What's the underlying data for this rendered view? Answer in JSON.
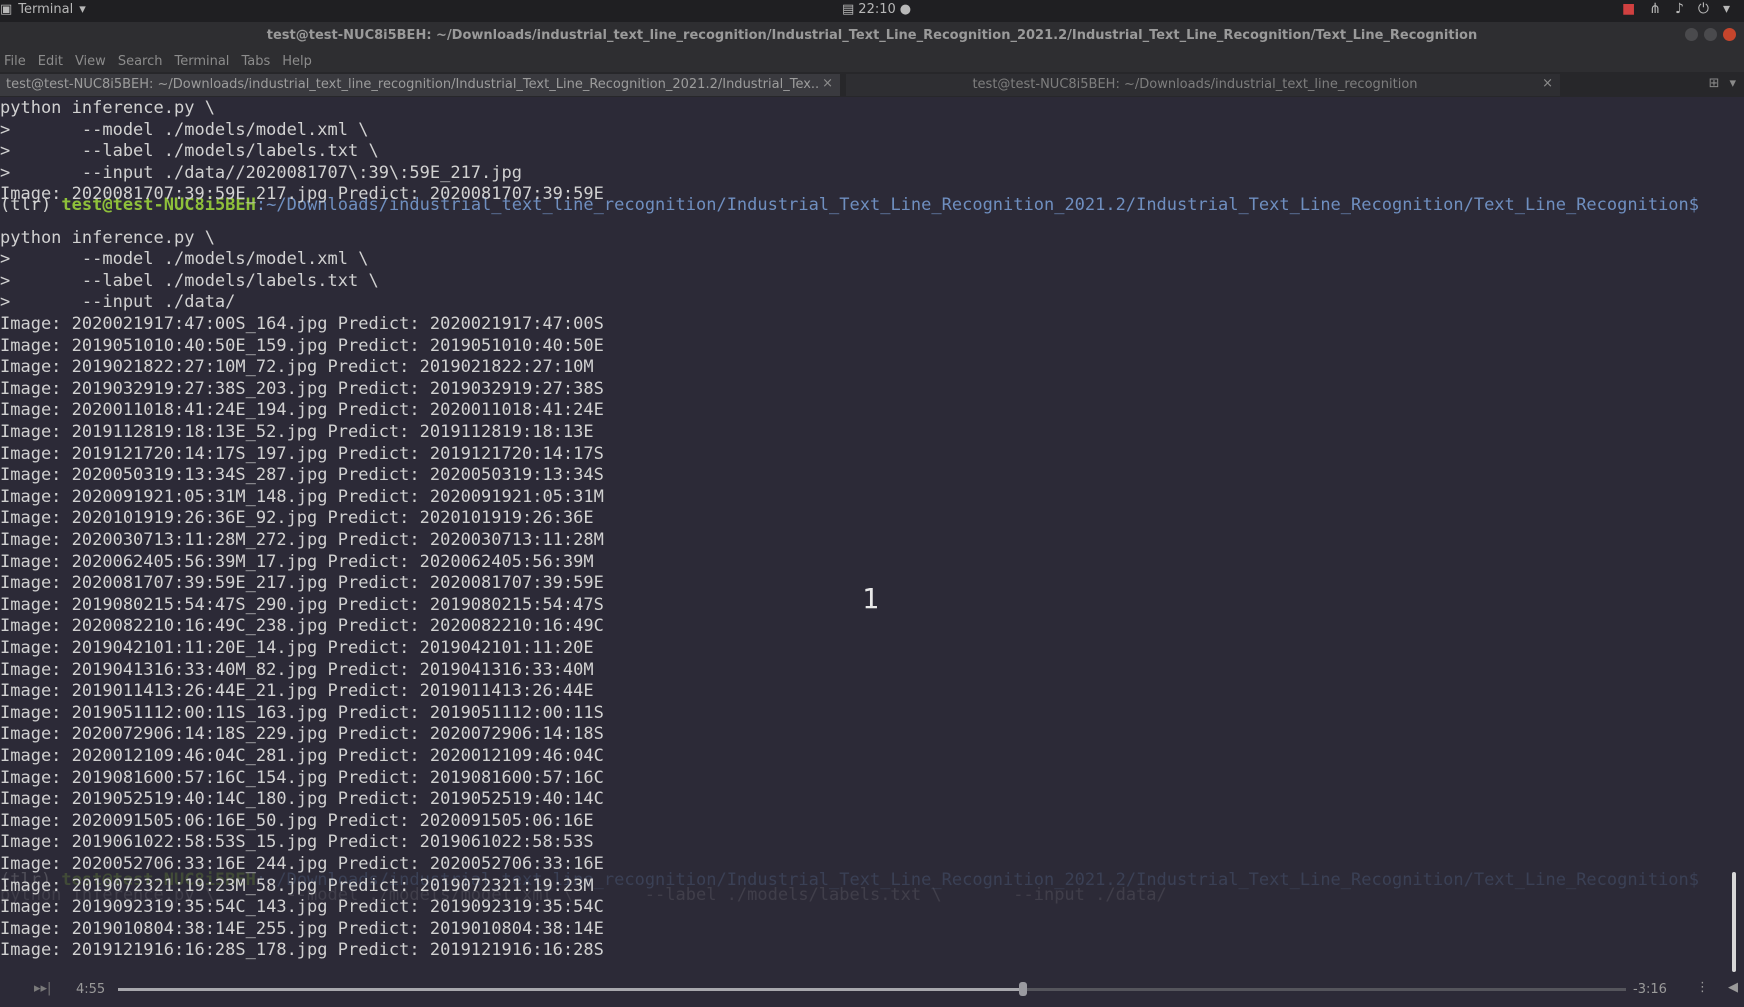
{
  "system_bar": {
    "app_name": "Terminal",
    "clock": "22:10"
  },
  "window": {
    "title": "test@test-NUC8i5BEH: ~/Downloads/industrial_text_line_recognition/Industrial_Text_Line_Recognition_2021.2/Industrial_Text_Line_Recognition/Text_Line_Recognition"
  },
  "menu": [
    "File",
    "Edit",
    "View",
    "Search",
    "Terminal",
    "Tabs",
    "Help"
  ],
  "tabs": [
    {
      "label": "test@test-NUC8i5BEH: ~/Downloads/industrial_text_line_recognition/Industrial_Text_Line_Recognition_2021.2/Industrial_Tex..."
    },
    {
      "label": "test@test-NUC8i5BEH: ~/Downloads/industrial_text_line_recognition"
    }
  ],
  "prompt": {
    "env": "(tlr) ",
    "user": "test@test-NUC8i5BEH",
    "path": ":~/Downloads/industrial_text_line_recognition/Industrial_Text_Line_Recognition_2021.2/Industrial_Text_Line_Recognition/Text_Line_Recognition$"
  },
  "terminal_lines": [
    "python inference.py \\",
    ">       --model ./models/model.xml \\",
    ">       --label ./models/labels.txt \\",
    ">       --input ./data//2020081707\\:39\\:59E_217.jpg",
    "Image: 2020081707:39:59E_217.jpg Predict: 2020081707:39:59E",
    "",
    "python inference.py \\",
    ">       --model ./models/model.xml \\",
    ">       --label ./models/labels.txt \\",
    ">       --input ./data/",
    "Image: 2020021917:47:00S_164.jpg Predict: 2020021917:47:00S",
    "Image: 2019051010:40:50E_159.jpg Predict: 2019051010:40:50E",
    "Image: 2019021822:27:10M_72.jpg Predict: 2019021822:27:10M",
    "Image: 2019032919:27:38S_203.jpg Predict: 2019032919:27:38S",
    "Image: 2020011018:41:24E_194.jpg Predict: 2020011018:41:24E",
    "Image: 2019112819:18:13E_52.jpg Predict: 2019112819:18:13E",
    "Image: 2019121720:14:17S_197.jpg Predict: 2019121720:14:17S",
    "Image: 2020050319:13:34S_287.jpg Predict: 2020050319:13:34S",
    "Image: 2020091921:05:31M_148.jpg Predict: 2020091921:05:31M",
    "Image: 2020101919:26:36E_92.jpg Predict: 2020101919:26:36E",
    "Image: 2020030713:11:28M_272.jpg Predict: 2020030713:11:28M",
    "Image: 2020062405:56:39M_17.jpg Predict: 2020062405:56:39M",
    "Image: 2020081707:39:59E_217.jpg Predict: 2020081707:39:59E",
    "Image: 2019080215:54:47S_290.jpg Predict: 2019080215:54:47S",
    "Image: 2020082210:16:49C_238.jpg Predict: 2020082210:16:49C",
    "Image: 2019042101:11:20E_14.jpg Predict: 2019042101:11:20E",
    "Image: 2019041316:33:40M_82.jpg Predict: 2019041316:33:40M",
    "Image: 2019011413:26:44E_21.jpg Predict: 2019011413:26:44E",
    "Image: 2019051112:00:11S_163.jpg Predict: 2019051112:00:11S",
    "Image: 2020072906:14:18S_229.jpg Predict: 2020072906:14:18S",
    "Image: 2020012109:46:04C_281.jpg Predict: 2020012109:46:04C",
    "Image: 2019081600:57:16C_154.jpg Predict: 2019081600:57:16C",
    "Image: 2019052519:40:14C_180.jpg Predict: 2019052519:40:14C",
    "Image: 2020091505:06:16E_50.jpg Predict: 2020091505:06:16E",
    "Image: 2019061022:58:53S_15.jpg Predict: 2019061022:58:53S",
    "Image: 2020052706:33:16E_244.jpg Predict: 2020052706:33:16E",
    "Image: 2019072321:19:23M_58.jpg Predict: 2019072321:19:23M",
    "Image: 2019092319:35:54C_143.jpg Predict: 2019092319:35:54C",
    "Image: 2019010804:38:14E_255.jpg Predict: 2019010804:38:14E",
    "Image: 2019121916:16:28S_178.jpg Predict: 2019121916:16:28S"
  ],
  "faded_last_line": "python inference.py \\       --model ./models/model.xml \\       --label ./models/labels.txt \\       --input ./data/",
  "overlay_number": "1",
  "player": {
    "elapsed": "4:55",
    "remaining": "-3:16",
    "progress": 0.6
  },
  "colors": {
    "background": "#2c2a37",
    "prompt_user": "#8ec03a",
    "prompt_path": "#6f8fc0"
  }
}
